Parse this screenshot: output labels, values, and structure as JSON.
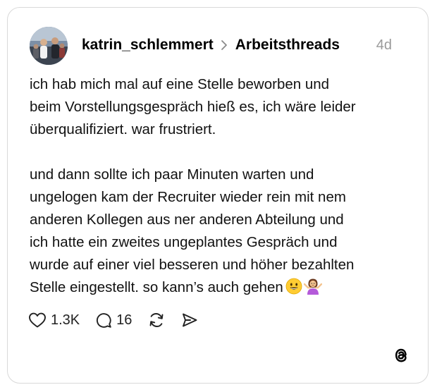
{
  "post": {
    "username": "katrin_schlemmert",
    "community": "Arbeitsthreads",
    "timestamp": "4d",
    "paragraphs": [
      "ich hab mich mal auf eine Stelle beworben und\nbeim Vorstellungsgespräch hieß es, ich wäre leider\nüberqualifiziert. war frustriert.",
      "und dann sollte ich paar Minuten warten und\nungelogen kam der Recruiter wieder rein mit nem\nanderen Kollegen aus ner anderen Abteilung und\nich hatte ein zweites ungeplantes Gespräch und\nwurde auf einer viel besseren und höher bezahlten\nStelle eingestellt. so kann’s auch gehen"
    ],
    "emojis": [
      "smiling-face-emoji",
      "person-shrugging-emoji"
    ]
  },
  "actions": {
    "likes": "1.3K",
    "replies": "16"
  },
  "icons": {
    "like": "heart-icon",
    "reply": "comment-icon",
    "repost": "repost-icon",
    "share": "send-icon",
    "brand": "threads-logo-icon"
  },
  "colors": {
    "text": "#111111",
    "muted": "#9a9a9a",
    "border": "#d9d9d9"
  }
}
